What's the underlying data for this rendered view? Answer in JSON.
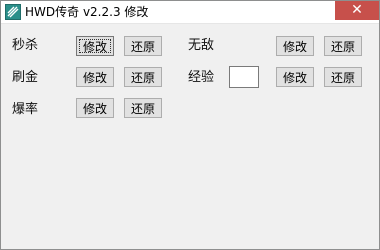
{
  "window": {
    "title": "HWD传奇 v2.2.3 修改",
    "close_glyph": "✕",
    "icon": "app-icon"
  },
  "rows": [
    {
      "label": "秒杀",
      "modify": "修改",
      "restore": "还原"
    },
    {
      "label": "刷金",
      "modify": "修改",
      "restore": "还原"
    },
    {
      "label": "爆率",
      "modify": "修改",
      "restore": "还原"
    }
  ],
  "right_rows": [
    {
      "label": "无敌",
      "modify": "修改",
      "restore": "还原"
    },
    {
      "label": "经验",
      "input_value": "",
      "modify": "修改",
      "restore": "还原"
    }
  ],
  "colors": {
    "close_button": "#c7504b",
    "background": "#f0f0f0"
  }
}
